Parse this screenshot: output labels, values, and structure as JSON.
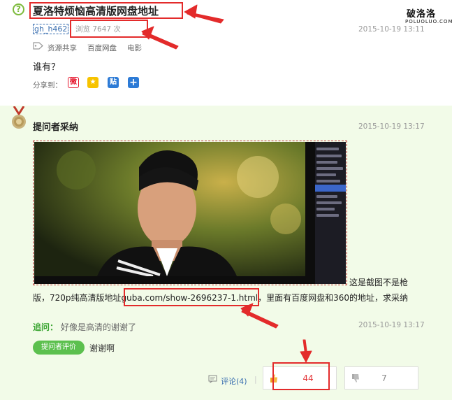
{
  "question": {
    "icon": "question-circle-icon",
    "title": "夏洛特烦恼高清版网盘地址",
    "user": "gh_h462",
    "views": "浏览 7647 次",
    "time": "2015-10-19 13:11",
    "tags": [
      "资源共享",
      "百度网盘",
      "电影"
    ],
    "body": "谁有？",
    "share_label": "分享到：",
    "share_icons": [
      "weibo-icon",
      "qzone-icon",
      "tieba-icon",
      "more-share-icon"
    ]
  },
  "watermark": {
    "main": "破洛洛",
    "sub": "POLUOLUO.COM"
  },
  "answer": {
    "medal_icon": "medal-icon",
    "label": "提问者采纳",
    "time": "2015-10-19 13:17",
    "text_line1": "这是截图不是枪",
    "text_line2_prefix": "版，720p纯高清版地址",
    "link": "guba.com/show-2696237-1.html",
    "text_line2_suffix": "，里面有百度网盘和360的地址，求采纳",
    "followup_label": "追问：",
    "followup_text": "好像是高清的谢谢了",
    "followup_time": "2015-10-19 13:17",
    "eval_badge": "提问者评价",
    "eval_text": "谢谢啊",
    "comment_label": "评论(4)",
    "upvotes": "44",
    "downvotes": "7"
  },
  "colors": {
    "accent_green": "#5cc04e",
    "annotation_red": "#e32b2b",
    "link_blue": "#3a6fb0",
    "panel_bg": "#f2fbe8"
  }
}
